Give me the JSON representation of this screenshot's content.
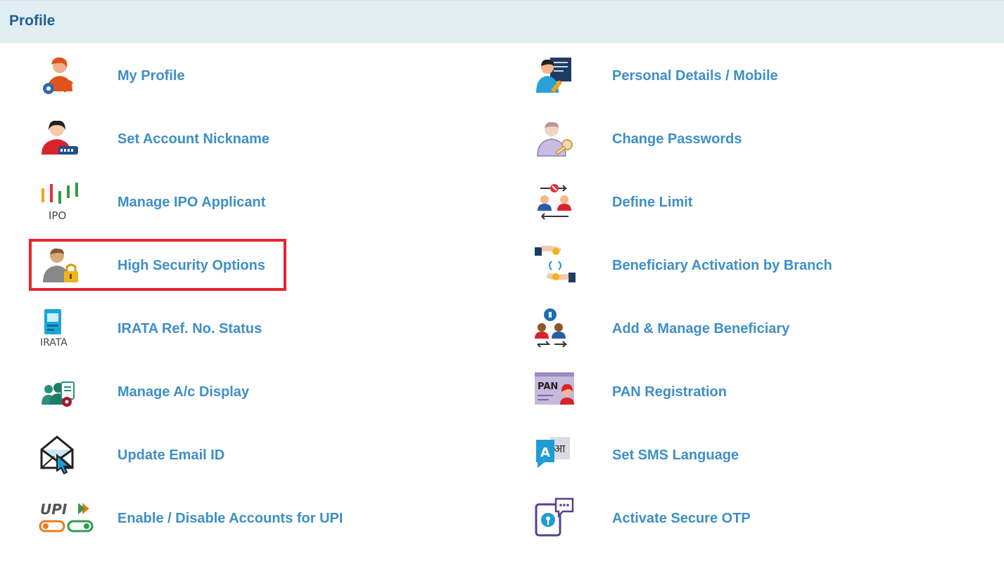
{
  "header": {
    "title": "Profile"
  },
  "left_items": [
    {
      "label": "My Profile",
      "icon": "user-gear-edit-icon"
    },
    {
      "label": "Set Account Nickname",
      "icon": "user-nickname-icon"
    },
    {
      "label": "Manage IPO Applicant",
      "icon": "ipo-chart-icon",
      "icon_text": "IPO"
    },
    {
      "label": "High Security Options",
      "icon": "user-lock-icon"
    },
    {
      "label": "IRATA Ref. No. Status",
      "icon": "atm-machine-icon",
      "icon_text": "IRATA"
    },
    {
      "label": "Manage A/c Display",
      "icon": "users-clipboard-gear-icon"
    },
    {
      "label": "Update Email ID",
      "icon": "envelope-cursor-icon"
    },
    {
      "label": "Enable / Disable Accounts for UPI",
      "icon": "upi-toggle-icon",
      "icon_text": "UPI"
    }
  ],
  "right_items": [
    {
      "label": "Personal Details / Mobile",
      "icon": "user-document-icon"
    },
    {
      "label": "Change Passwords",
      "icon": "user-key-icon"
    },
    {
      "label": "Define Limit",
      "icon": "users-exchange-limit-icon"
    },
    {
      "label": "Beneficiary Activation by Branch",
      "icon": "coin-transfer-icon"
    },
    {
      "label": "Add & Manage Beneficiary",
      "icon": "beneficiary-people-icon"
    },
    {
      "label": "PAN Registration",
      "icon": "pan-card-icon",
      "icon_text": "PAN"
    },
    {
      "label": "Set SMS Language",
      "icon": "language-translate-icon",
      "icon_text": "A",
      "icon_text_alt": "आ"
    },
    {
      "label": "Activate Secure OTP",
      "icon": "mobile-otp-icon"
    }
  ],
  "highlight": {
    "target": "High Security Options",
    "color": "#e8242b"
  },
  "colors": {
    "link": "#3e8fc6",
    "header_bg": "#e0eef2",
    "header_text": "#1f5f93"
  }
}
